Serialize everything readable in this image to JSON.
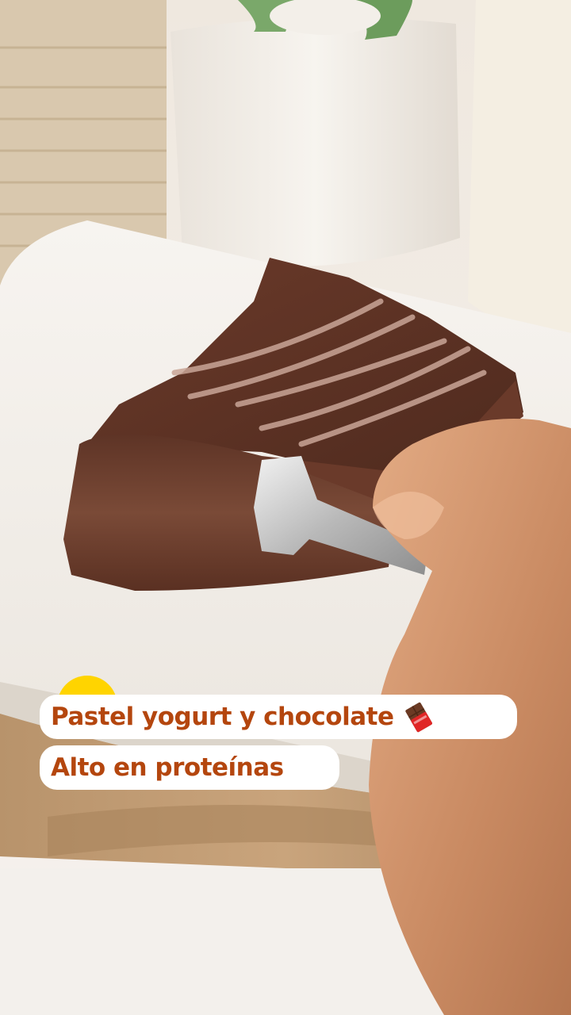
{
  "captions": {
    "line1": "Pastel yogurt y chocolate",
    "line2": "Alto en proteínas"
  },
  "icons": {
    "caption_emoji": "chocolate-bar-icon"
  },
  "colors": {
    "caption_text": "#b4460e",
    "caption_bg": "#ffffff",
    "accent_dot": "#ffd400"
  }
}
